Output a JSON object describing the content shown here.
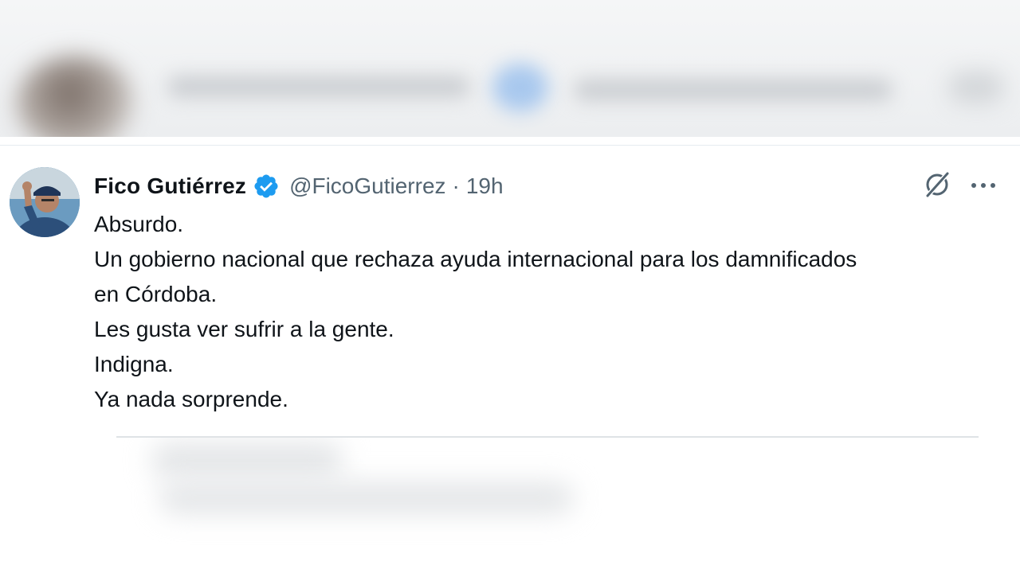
{
  "tweet": {
    "display_name": "Fico Gutiérrez",
    "handle": "@FicoGutierrez",
    "separator": "·",
    "time": "19h",
    "lines": [
      "Absurdo.",
      "Un gobierno nacional que rechaza ayuda internacional para los damnificados",
      "en Córdoba.",
      "Les gusta ver sufrir a la gente.",
      "Indigna.",
      "Ya nada sorprende."
    ]
  },
  "icons": {
    "verified": "verified-badge-icon",
    "grok": "grok-icon",
    "more": "more-options-icon"
  },
  "colors": {
    "text_primary": "#0f1419",
    "text_secondary": "#536471",
    "verified_blue": "#1d9bf0",
    "divider": "#dfe3e6"
  }
}
